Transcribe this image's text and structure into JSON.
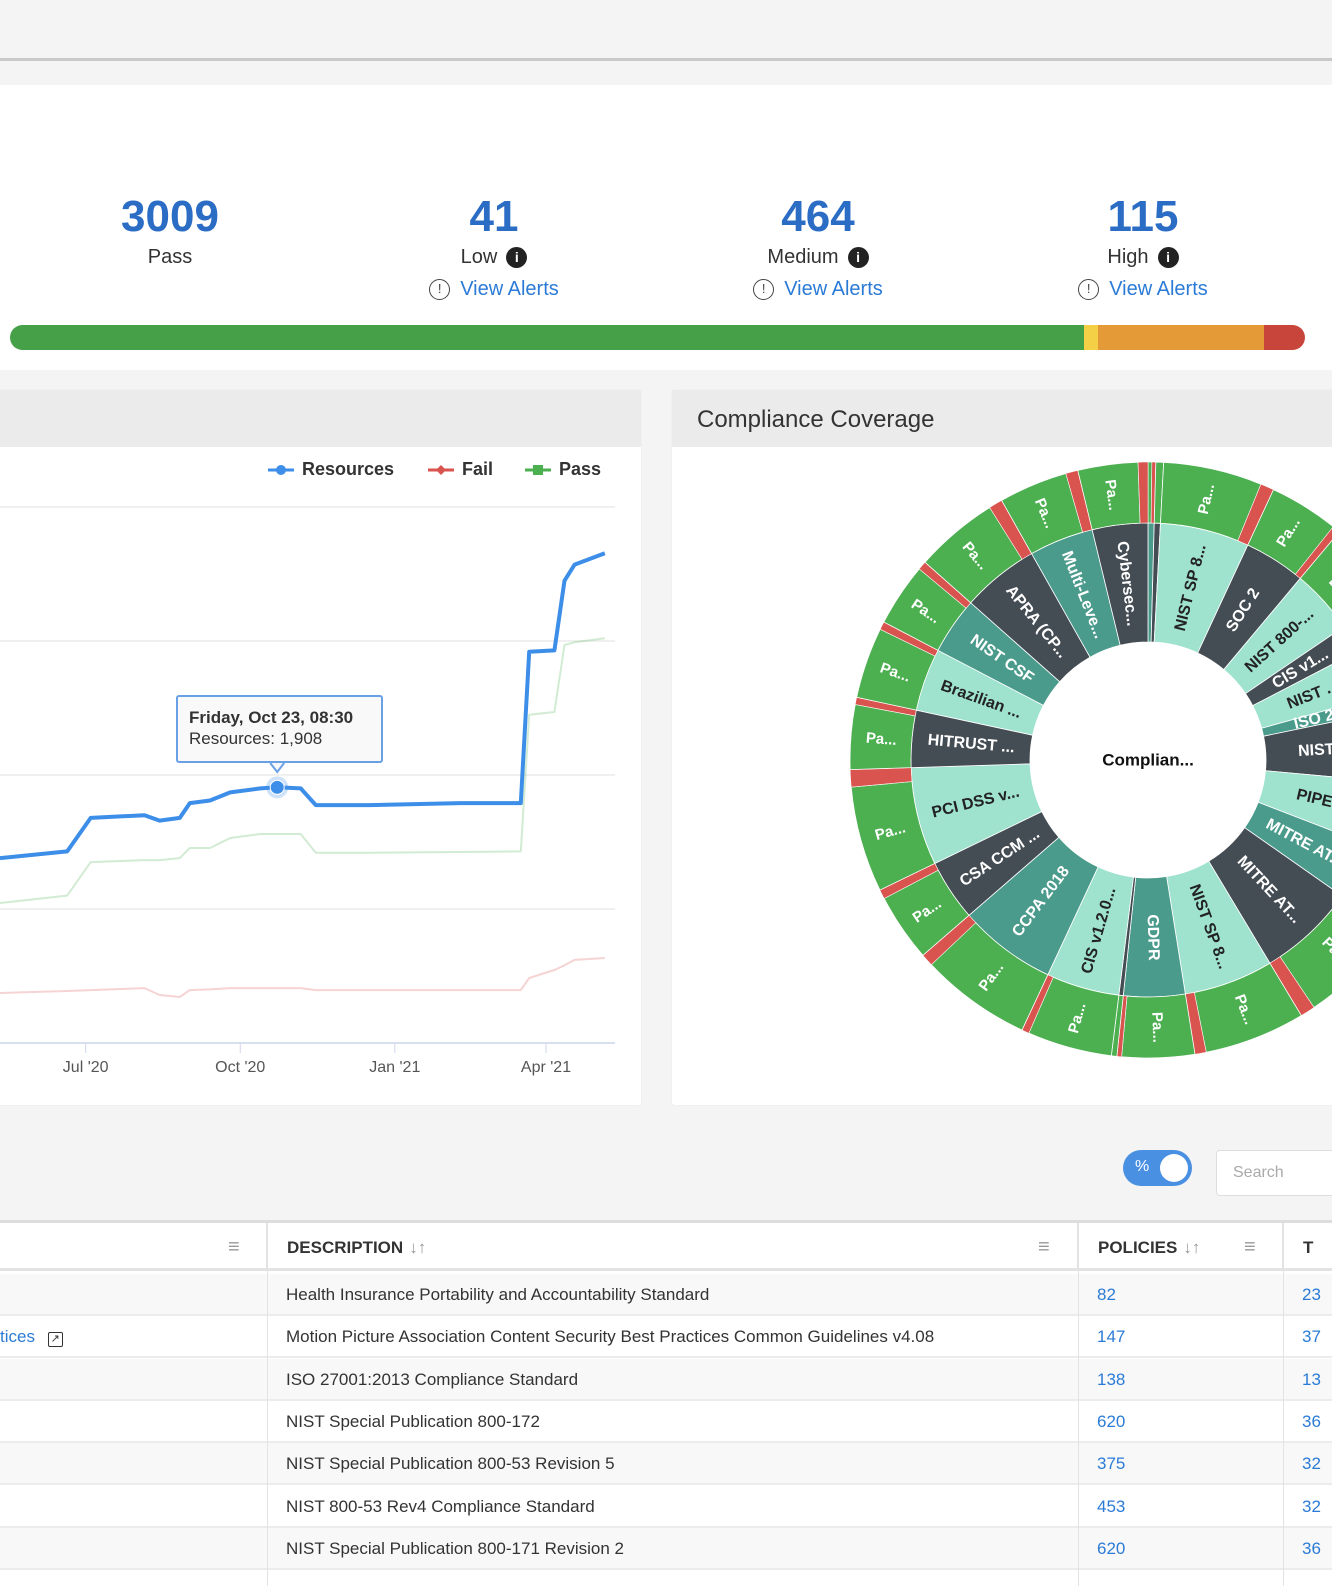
{
  "summary": {
    "stats": [
      {
        "value": "3009",
        "label": "Pass"
      },
      {
        "value": "41",
        "label": "Low",
        "link": "View Alerts"
      },
      {
        "value": "464",
        "label": "Medium",
        "link": "View Alerts"
      },
      {
        "value": "115",
        "label": "High",
        "link": "View Alerts"
      }
    ]
  },
  "severity_bar": {
    "segments": [
      {
        "name": "Pass",
        "value": 3009,
        "color": "#46a048"
      },
      {
        "name": "Low",
        "value": 41,
        "color": "#f4d046"
      },
      {
        "name": "Medium",
        "value": 464,
        "color": "#e49b37"
      },
      {
        "name": "High",
        "value": 115,
        "color": "#c8453c"
      }
    ]
  },
  "coverage": {
    "title": "Compliance Coverage"
  },
  "chart_data": [
    {
      "type": "line",
      "title": "",
      "xlabel": "",
      "ylabel": "",
      "ylim": [
        0,
        4000
      ],
      "grid": true,
      "legend": "top-right",
      "x_ticks": [
        "Jul '20",
        "Oct '20",
        "Jan '21",
        "Apr '21"
      ],
      "x": [
        "2020-05-11",
        "2020-06-20",
        "2020-07-04",
        "2020-08-05",
        "2020-08-14",
        "2020-08-26",
        "2020-09-01",
        "2020-09-13",
        "2020-09-25",
        "2020-10-13",
        "2020-10-23",
        "2020-11-06",
        "2020-11-15",
        "2020-12-17",
        "2021-02-09",
        "2021-03-17",
        "2021-03-22",
        "2021-04-06",
        "2021-04-12",
        "2021-04-18",
        "2021-05-06"
      ],
      "series": [
        {
          "name": "Resources",
          "color": "#3d8ee8",
          "values": [
            1380,
            1430,
            1680,
            1700,
            1660,
            1680,
            1790,
            1810,
            1870,
            1900,
            1908,
            1900,
            1775,
            1775,
            1790,
            1790,
            2920,
            2930,
            3450,
            3570,
            3655
          ]
        },
        {
          "name": "Fail",
          "color": "#d9534f",
          "values": [
            373,
            388,
            395,
            410,
            358,
            343,
            395,
            400,
            410,
            410,
            410,
            410,
            395,
            395,
            395,
            395,
            485,
            545,
            580,
            620,
            634
          ]
        },
        {
          "name": "Pass",
          "color": "#4caf50",
          "values": [
            1045,
            1100,
            1350,
            1365,
            1365,
            1380,
            1455,
            1455,
            1530,
            1560,
            1560,
            1560,
            1420,
            1420,
            1425,
            1430,
            2450,
            2470,
            2970,
            2990,
            3020
          ]
        }
      ],
      "tooltip": {
        "title": "Friday, Oct 23, 08:30",
        "text": "Resources: 1,908",
        "date": "2020-10-23",
        "value": 1908
      }
    },
    {
      "type": "pie",
      "title": "",
      "center_label": "Complian...",
      "outer_label": "Pa...",
      "colors": {
        "dark": "#444c54",
        "teal": "#4b9b8c",
        "light": "#9fe3cf",
        "pass": "#4caf50",
        "fail": "#d9534f"
      },
      "segments": [
        {
          "label": "",
          "value": 0.42,
          "tone": "teal",
          "fail": 0.5
        },
        {
          "label": "",
          "value": 0.42,
          "tone": "dark",
          "fail": 0
        },
        {
          "label": "NIST SP 8...",
          "value": 6.1,
          "tone": "light",
          "fail": 0.12
        },
        {
          "label": "SOC 2",
          "value": 4.2,
          "tone": "dark",
          "fail": 0.1
        },
        {
          "label": "NIST 800-...",
          "value": 4.4,
          "tone": "light",
          "fail": 0.12
        },
        {
          "label": "CIS v1...",
          "value": 1.9,
          "tone": "dark",
          "fail": 0.1
        },
        {
          "label": "NIST ...",
          "value": 3.3,
          "tone": "light",
          "fail": 0.1
        },
        {
          "label": "ISO 2...",
          "value": 1.1,
          "tone": "teal",
          "fail": 0.1
        },
        {
          "label": "NIST ...",
          "value": 4.7,
          "tone": "dark",
          "fail": 0.1
        },
        {
          "label": "PIPE...",
          "value": 4.4,
          "tone": "light",
          "fail": 0.1
        },
        {
          "label": "MITRE AT...",
          "value": 3.9,
          "tone": "teal",
          "fail": 0.1
        },
        {
          "label": "MITRE AT...",
          "value": 6.7,
          "tone": "dark",
          "fail": 0.12
        },
        {
          "label": "NIST SP 8...",
          "value": 6.1,
          "tone": "light",
          "fail": 0.1
        },
        {
          "label": "GDPR",
          "value": 4.2,
          "tone": "teal",
          "fail": 0.06
        },
        {
          "label": "",
          "value": 0.3,
          "tone": "dark",
          "fail": 0
        },
        {
          "label": "CIS v1.2.0...",
          "value": 5.0,
          "tone": "light",
          "fail": 0.08
        },
        {
          "label": "CCPA 2018",
          "value": 6.7,
          "tone": "teal",
          "fail": 0.1
        },
        {
          "label": "CSA CCM ...",
          "value": 4.2,
          "tone": "dark",
          "fail": 0.12
        },
        {
          "label": "PCI DSS v...",
          "value": 6.7,
          "tone": "light",
          "fail": 0.14
        },
        {
          "label": "HITRUST ...",
          "value": 3.9,
          "tone": "dark",
          "fail": 0.1
        },
        {
          "label": "Brazilian ...",
          "value": 4.3,
          "tone": "light",
          "fail": 0.1
        },
        {
          "label": "NIST CSF",
          "value": 3.9,
          "tone": "teal",
          "fail": 0.12
        },
        {
          "label": "APRA (CP...",
          "value": 5.3,
          "tone": "dark",
          "fail": 0.14
        },
        {
          "label": "Multi-Leve...",
          "value": 4.4,
          "tone": "teal",
          "fail": 0.15
        },
        {
          "label": "Cybersec...",
          "value": 3.8,
          "tone": "dark",
          "fail": 0.14
        }
      ]
    }
  ],
  "table_toolbar": {
    "toggle_label": "%",
    "search_placeholder": "Search"
  },
  "table": {
    "columns": [
      {
        "label": ""
      },
      {
        "label": "DESCRIPTION",
        "sort": "↓↑"
      },
      {
        "label": "POLICIES",
        "sort": "↓↑"
      },
      {
        "label": "T"
      }
    ],
    "menu_glyph": "≡",
    "rows": [
      {
        "name": "",
        "description": "Health Insurance Portability and Accountability Standard",
        "policies": "82",
        "last": "23"
      },
      {
        "name": "tices",
        "description": "Motion Picture Association Content Security Best Practices Common Guidelines v4.08",
        "policies": "147",
        "last": "37"
      },
      {
        "name": "",
        "description": "ISO 27001:2013 Compliance Standard",
        "policies": "138",
        "last": "13"
      },
      {
        "name": "",
        "description": "NIST Special Publication 800-172",
        "policies": "620",
        "last": "36"
      },
      {
        "name": "",
        "description": "NIST Special Publication 800-53 Revision 5",
        "policies": "375",
        "last": "32"
      },
      {
        "name": "",
        "description": "NIST 800-53 Rev4 Compliance Standard",
        "policies": "453",
        "last": "32"
      },
      {
        "name": "",
        "description": "NIST Special Publication 800-171 Revision 2",
        "policies": "620",
        "last": "36"
      }
    ]
  }
}
